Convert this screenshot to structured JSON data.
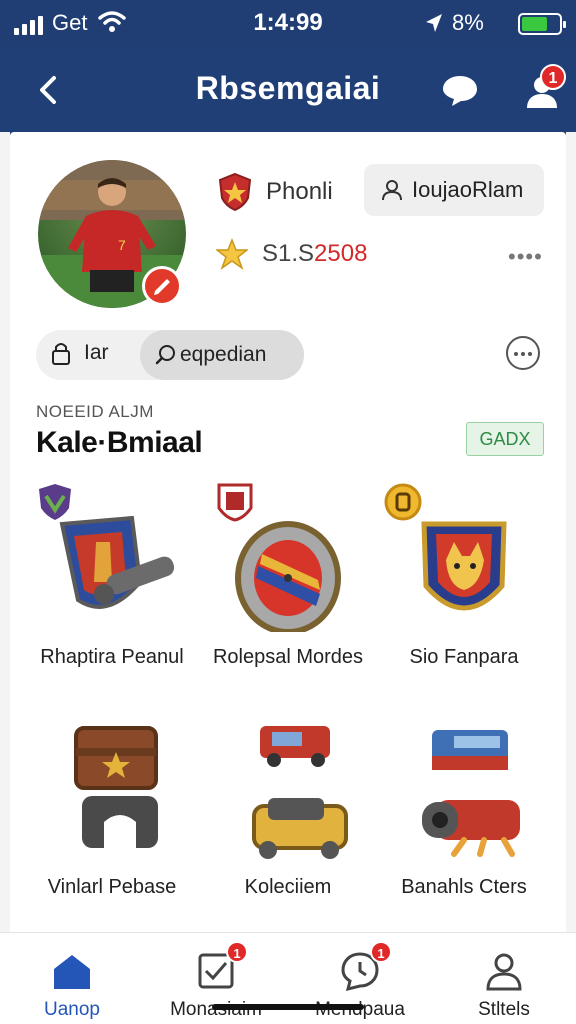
{
  "status_bar": {
    "carrier": "Get",
    "time": "1:4:99",
    "battery_text": "8%",
    "battery_level": 0.7
  },
  "nav": {
    "title": "Rbsemgaiai",
    "profile_badge": "1",
    "icons": {
      "back": "chevron-left-icon",
      "chat": "chat-bubble-icon",
      "profile": "user-icon"
    }
  },
  "profile": {
    "rank_label": "Phonli",
    "follow_button": "IoujaoRlam",
    "score_prefix": "S1.S",
    "score_highlight": "2508",
    "more": "••••"
  },
  "pills": {
    "first_label": "Iar",
    "second_label": "eqpedian"
  },
  "section": {
    "kicker": "NOEEID ALJM",
    "title": "Kale·Bmiaal",
    "tag": "GADX"
  },
  "items": [
    {
      "name": "Rhaptira Peanul",
      "icon": "shield-cannon-icon"
    },
    {
      "name": "Rolepsal Mordes",
      "icon": "round-shield-icon"
    },
    {
      "name": "Sio Fanpara",
      "icon": "fox-shield-icon"
    },
    {
      "name": "Vinlarl Pebase",
      "icon": "chest-anvil-icon"
    },
    {
      "name": "Koleciiem",
      "icon": "gold-cannon-icon"
    },
    {
      "name": "Banahls Cters",
      "icon": "wagon-cannon-icon"
    }
  ],
  "tabs": [
    {
      "label": "Uanop",
      "icon": "home-icon",
      "badge": ""
    },
    {
      "label": "Monasiaim",
      "icon": "checklist-icon",
      "badge": "1"
    },
    {
      "label": "Mendpaua",
      "icon": "clock-chat-icon",
      "badge": "1"
    },
    {
      "label": "Stltels",
      "icon": "user-icon",
      "badge": ""
    }
  ],
  "colors": {
    "header": "#213f77",
    "accent_red": "#e02828",
    "tab_active": "#2456b8",
    "tag_green": "#2e8b43"
  }
}
